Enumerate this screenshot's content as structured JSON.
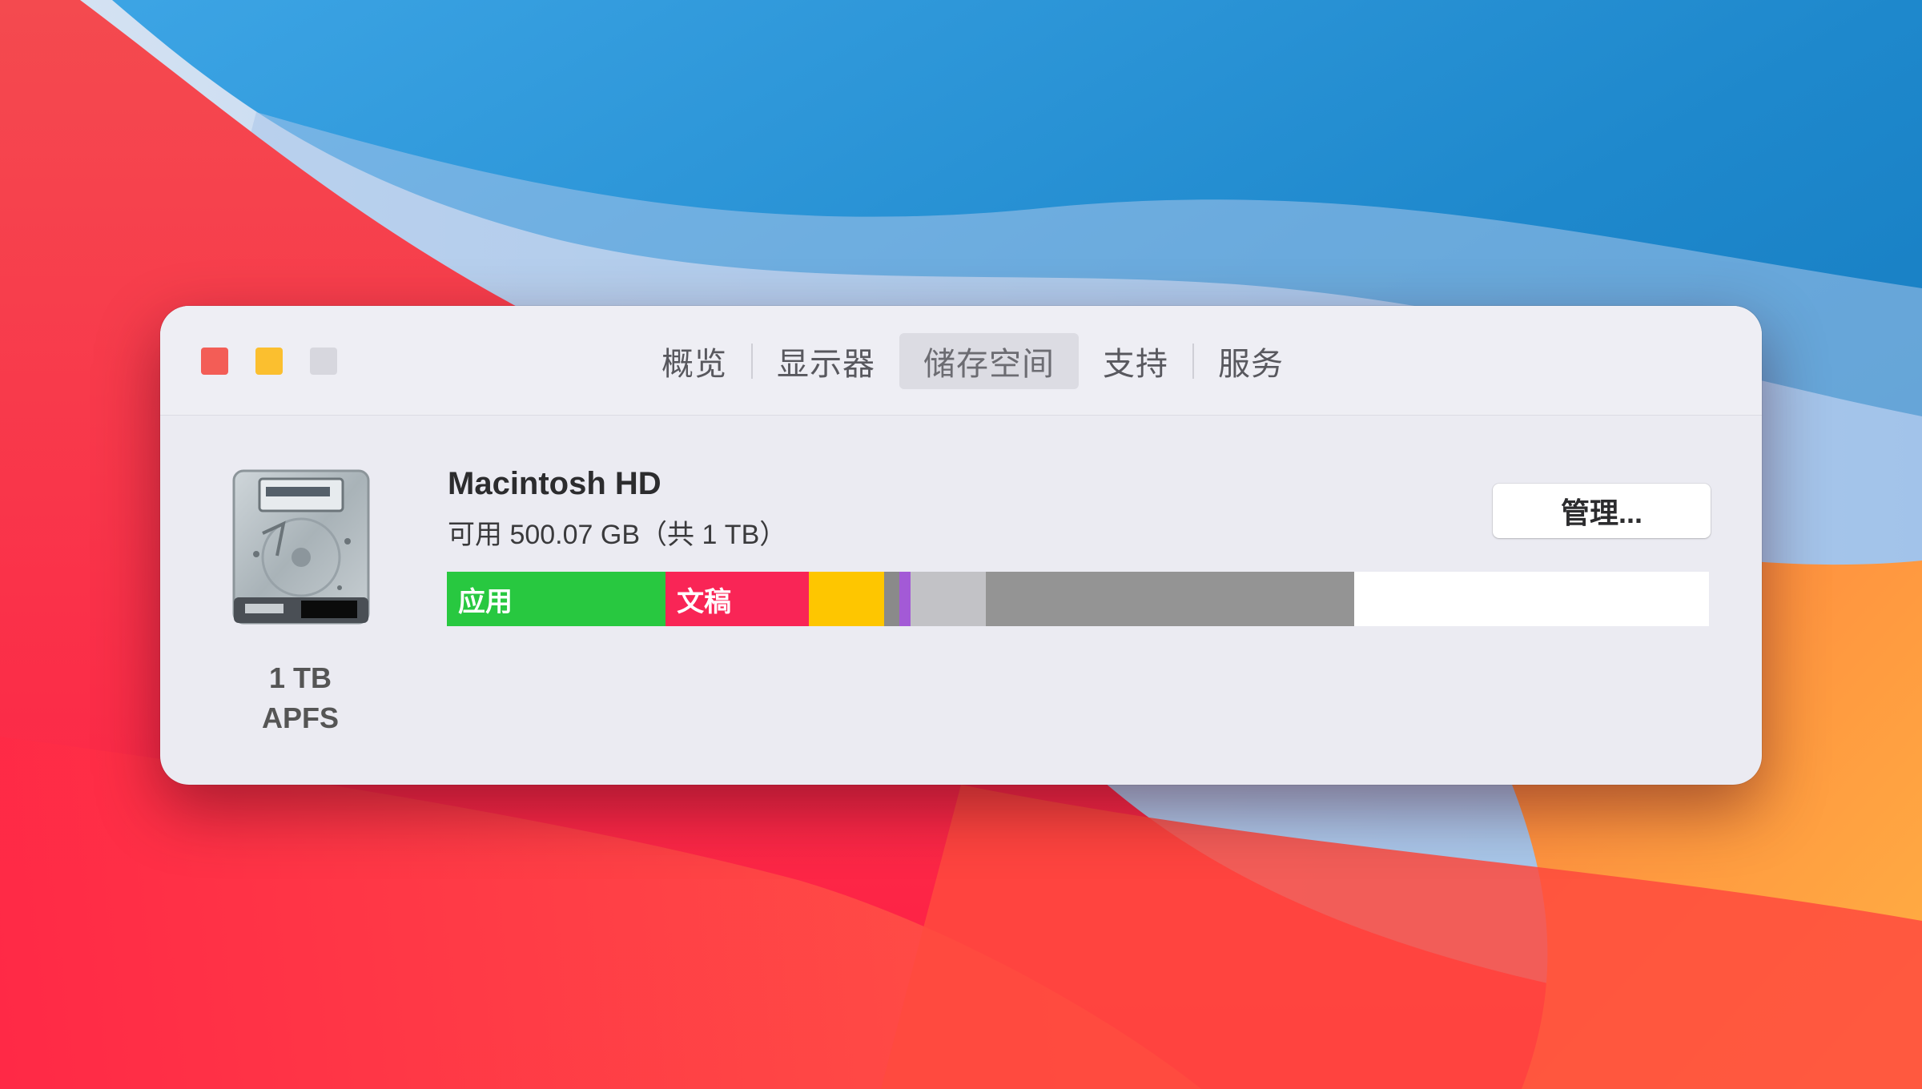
{
  "window": {
    "controls": {
      "close_color": "#f35d56",
      "minimize_color": "#fbbf2f",
      "zoom_color": "#d7d7de"
    },
    "tabs": [
      {
        "label": "概览",
        "selected": false
      },
      {
        "label": "显示器",
        "selected": false
      },
      {
        "label": "储存空间",
        "selected": true
      },
      {
        "label": "支持",
        "selected": false
      },
      {
        "label": "服务",
        "selected": false
      }
    ]
  },
  "disk": {
    "icon": "hard-drive-icon",
    "name": "Macintosh HD",
    "usage_text": "可用 500.07 GB（共 1 TB）",
    "label_line1": "1 TB",
    "label_line2": "APFS",
    "manage_label": "管理..."
  },
  "storage_bar": {
    "segments": [
      {
        "name": "apps",
        "label": "应用",
        "color": "#28c840",
        "fraction": 0.174
      },
      {
        "name": "documents",
        "label": "文稿",
        "color": "#f92556",
        "fraction": 0.114
      },
      {
        "name": "system-data",
        "label": "",
        "color": "#fec600",
        "fraction": 0.06
      },
      {
        "name": "other-a",
        "label": "",
        "color": "#8a8a8a",
        "fraction": 0.012
      },
      {
        "name": "other-b",
        "label": "",
        "color": "#a35ad6",
        "fraction": 0.005
      },
      {
        "name": "purgeable",
        "label": "",
        "color": "#c2c2c6",
        "fraction": 0.06
      },
      {
        "name": "system",
        "label": "",
        "color": "#949494",
        "fraction": 0.293
      },
      {
        "name": "free",
        "label": "",
        "color": "#ffffff",
        "fraction": 0.282
      }
    ]
  }
}
